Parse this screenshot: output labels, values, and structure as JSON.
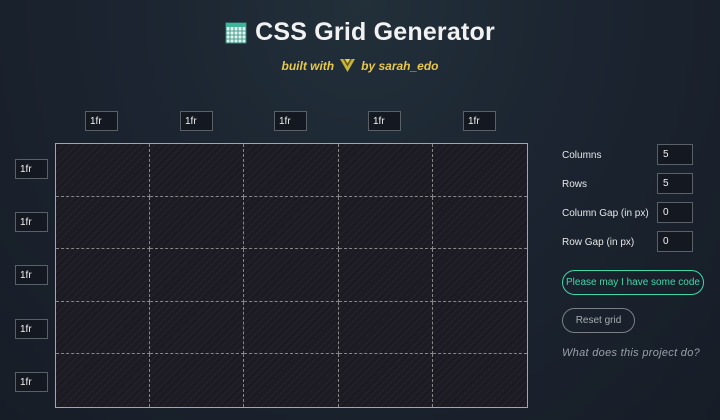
{
  "header": {
    "title": "CSS Grid Generator",
    "subtitle_prefix": "built with",
    "subtitle_suffix": "by sarah_edo",
    "title_icon": "grid-layout-icon",
    "subtitle_icon": "vue-icon"
  },
  "columns": [
    {
      "value": "1fr"
    },
    {
      "value": "1fr"
    },
    {
      "value": "1fr"
    },
    {
      "value": "1fr"
    },
    {
      "value": "1fr"
    }
  ],
  "rows": [
    {
      "value": "1fr"
    },
    {
      "value": "1fr"
    },
    {
      "value": "1fr"
    },
    {
      "value": "1fr"
    },
    {
      "value": "1fr"
    }
  ],
  "controls": {
    "columns_label": "Columns",
    "columns_value": "5",
    "rows_label": "Rows",
    "rows_value": "5",
    "column_gap_label": "Column Gap (in px)",
    "column_gap_value": "0",
    "row_gap_label": "Row Gap (in px)",
    "row_gap_value": "0"
  },
  "buttons": {
    "code_label": "Please may I have some code",
    "reset_label": "Reset grid"
  },
  "about_link": "What does this project do?",
  "colors": {
    "accent": "#3fd8a8",
    "subtitle": "#e8c84a",
    "background": "#1b2430"
  }
}
